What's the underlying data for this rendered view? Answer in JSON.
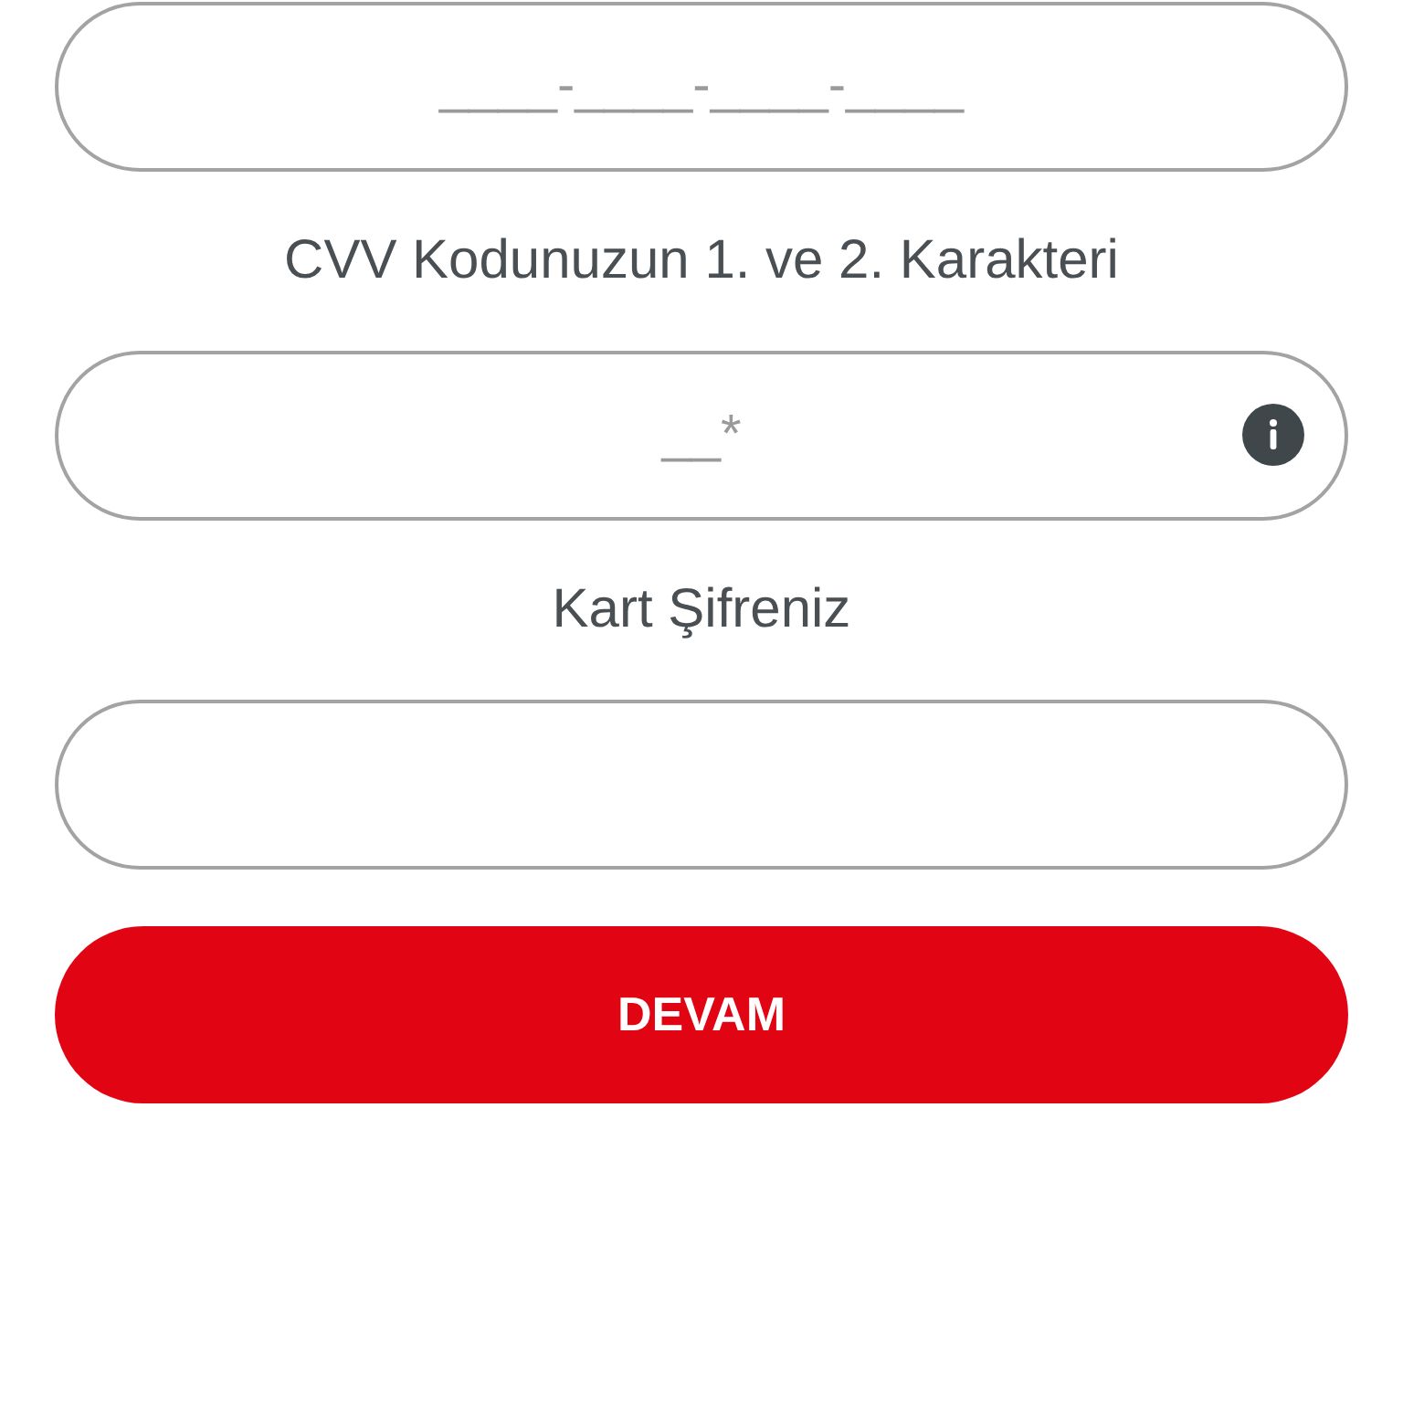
{
  "form": [
    {
      "kind": "field",
      "placeholder": "____-____-____-____"
    },
    {
      "kind": "label",
      "text": "CVV Kodunuzun 1. ve 2. Karakteri"
    },
    {
      "kind": "field",
      "placeholder": "__*",
      "info_button": true
    },
    {
      "kind": "label",
      "text": "Kart Şifreniz"
    },
    {
      "kind": "field"
    },
    {
      "kind": "button",
      "label": "DEVAM"
    }
  ]
}
